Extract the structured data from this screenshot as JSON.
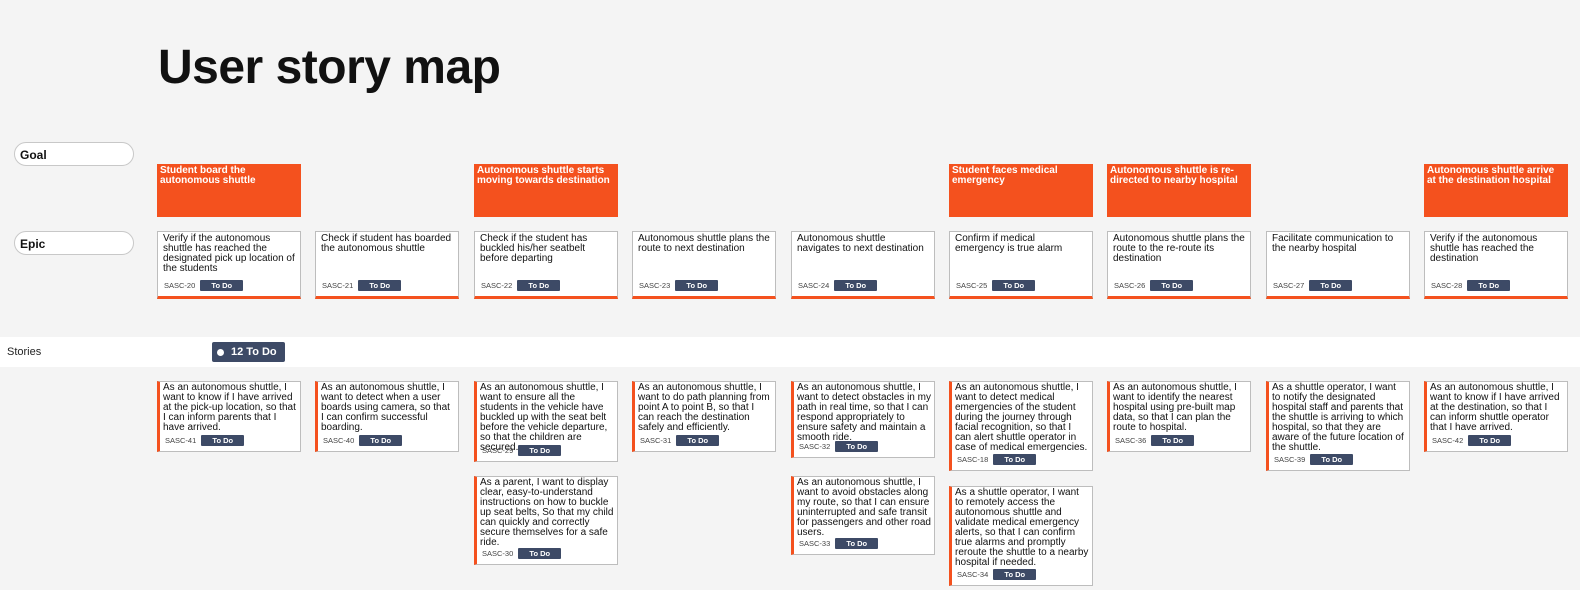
{
  "page": {
    "title": "User story map"
  },
  "rows": {
    "goal": "Goal",
    "epic": "Epic",
    "stories": "Stories"
  },
  "stories_summary": {
    "count_label": "12 To Do"
  },
  "goals": [
    {
      "col": 0,
      "text": "Student board the autonomous shuttle"
    },
    {
      "col": 2,
      "text": "Autonomous shuttle starts moving towards destination"
    },
    {
      "col": 5,
      "text": "Student faces medical emergency"
    },
    {
      "col": 6,
      "text": "Autonomous shuttle is re-directed to nearby hospital"
    },
    {
      "col": 8,
      "text": "Autonomous shuttle arrive at the destination hospital"
    }
  ],
  "epics": [
    {
      "text": "Verify if the autonomous shuttle has reached the designated pick up location of the students",
      "key": "SASC-20",
      "status": "To Do"
    },
    {
      "text": "Check if student has boarded the autonomous shuttle",
      "key": "SASC-21",
      "status": "To Do"
    },
    {
      "text": "Check if the student has buckled his/her seatbelt before departing",
      "key": "SASC-22",
      "status": "To Do"
    },
    {
      "text": "Autonomous shuttle plans the route to next destination",
      "key": "SASC-23",
      "status": "To Do"
    },
    {
      "text": "Autonomous shuttle navigates to next destination",
      "key": "SASC-24",
      "status": "To Do"
    },
    {
      "text": "Confirm if medical emergency is true alarm",
      "key": "SASC-25",
      "status": "To Do"
    },
    {
      "text": "Autonomous shuttle plans the route to the re-route its destination",
      "key": "SASC-26",
      "status": "To Do"
    },
    {
      "text": "Facilitate communication to the nearby hospital",
      "key": "SASC-27",
      "status": "To Do"
    },
    {
      "text": "Verify if the autonomous shuttle has reached the destination",
      "key": "SASC-28",
      "status": "To Do"
    }
  ],
  "stories": [
    {
      "col": 0,
      "text": "As an autonomous shuttle, I want to know if I have arrived at the pick-up location, so that I can inform parents that I have arrived.",
      "key": "SASC-41",
      "status": "To Do"
    },
    {
      "col": 1,
      "text": "As an autonomous shuttle, I want to detect when a user boards using camera, so that I can confirm successful boarding.",
      "key": "SASC-40",
      "status": "To Do"
    },
    {
      "col": 2,
      "text": "As an autonomous shuttle, I want to ensure all the students in the vehicle have buckled up with the seat belt before the vehicle departure, so that the children are secured.",
      "key": "SASC-29",
      "status": "To Do"
    },
    {
      "col": 2,
      "text": "As a parent, I want to display clear, easy-to-understand instructions on how to buckle up seat belts, So that my child can quickly and correctly secure themselves for a safe ride.",
      "key": "SASC-30",
      "status": "To Do"
    },
    {
      "col": 3,
      "text": "As an autonomous shuttle, I want to do path planning from point A to point B, so that I can reach the destination safely and efficiently.",
      "key": "SASC-31",
      "status": "To Do"
    },
    {
      "col": 4,
      "text": "As an autonomous shuttle, I want to detect obstacles in my path in real time, so that I can respond appropriately to ensure safety and maintain a smooth ride.",
      "key": "SASC-32",
      "status": "To Do"
    },
    {
      "col": 4,
      "text": "As an autonomous shuttle, I want to avoid obstacles along my route, so that I can ensure uninterrupted and safe transit for passengers and other road users.",
      "key": "SASC-33",
      "status": "To Do"
    },
    {
      "col": 5,
      "text": "As an autonomous shuttle, I want to detect medical emergencies of the student during the journey through facial recognition, so that I can alert shuttle operator in case of medical emergencies.",
      "key": "SASC-18",
      "status": "To Do"
    },
    {
      "col": 5,
      "text": "As a shuttle operator, I want to remotely access the autonomous shuttle and validate medical emergency alerts, so that I can confirm true alarms and promptly reroute the shuttle to a nearby hospital if needed.",
      "key": "SASC-34",
      "status": "To Do"
    },
    {
      "col": 6,
      "text": "As an autonomous shuttle, I want to identify the nearest hospital using pre-built map data, so that I can plan the route to hospital.",
      "key": "SASC-36",
      "status": "To Do"
    },
    {
      "col": 7,
      "text": "As a shuttle operator, I want to notify the designated hospital staff and parents that the shuttle is arriving to which hospital, so that they are aware of the future location of the shuttle.",
      "key": "SASC-39",
      "status": "To Do"
    },
    {
      "col": 8,
      "text": "As an autonomous shuttle, I want to know if I have arrived at the destination, so that I can inform shuttle operator that I have arrived.",
      "key": "SASC-42",
      "status": "To Do"
    }
  ]
}
